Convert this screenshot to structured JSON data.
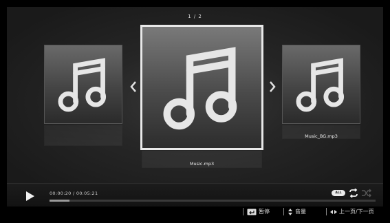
{
  "page_indicator": "1 / 2",
  "carousel": {
    "items": [
      {
        "label": ""
      },
      {
        "label": "Music.mp3"
      },
      {
        "label": "Music_BG.mp3"
      }
    ],
    "icon": "music-note-icon"
  },
  "player": {
    "time_text": "00:00:20 / 00:05:21",
    "progress": 0.062,
    "mode_badge": "ALL",
    "icons": [
      "play-icon",
      "repeat-icon",
      "shuffle-icon"
    ]
  },
  "hints": {
    "pause": "暂停",
    "volume": "音量",
    "page": "上一页/下一页"
  },
  "colors": {
    "background": "#000000",
    "panel": "#262626",
    "highlight_border": "#e8e8e8",
    "text": "#dddddd"
  }
}
